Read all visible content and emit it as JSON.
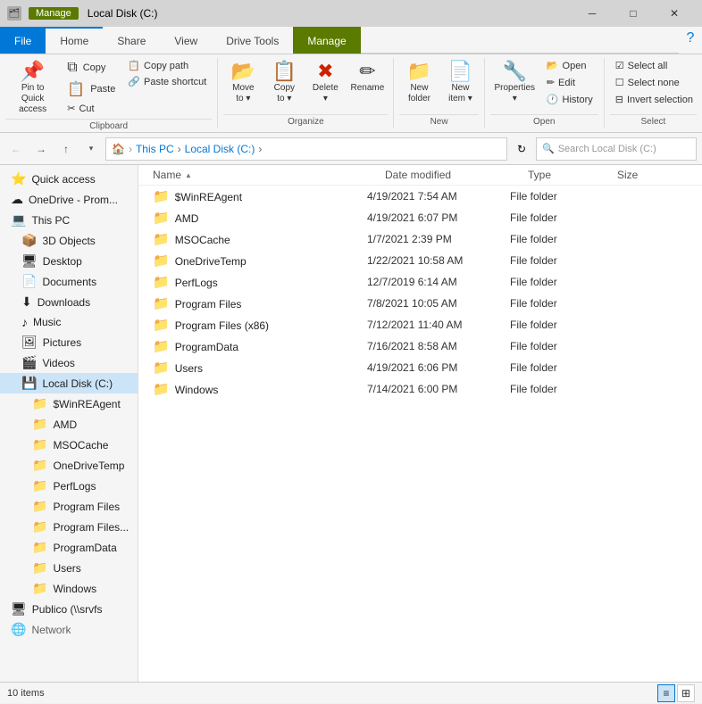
{
  "titlebar": {
    "manage_label": "Manage",
    "title": "Local Disk (C:)",
    "min": "─",
    "max": "□",
    "close": "✕"
  },
  "ribbon": {
    "tabs": [
      {
        "id": "file",
        "label": "File",
        "active_file": true
      },
      {
        "id": "home",
        "label": "Home",
        "active": true
      },
      {
        "id": "share",
        "label": "Share"
      },
      {
        "id": "view",
        "label": "View"
      },
      {
        "id": "drive_tools",
        "label": "Drive Tools"
      },
      {
        "id": "manage",
        "label": "Manage",
        "manage": true
      }
    ],
    "groups": {
      "clipboard": {
        "label": "Clipboard",
        "pin_label": "Pin to Quick\naccess",
        "copy_label": "Copy",
        "paste_label": "Paste",
        "cut_label": "Cut",
        "copy_path_label": "Copy path",
        "paste_shortcut_label": "Paste shortcut"
      },
      "organize": {
        "label": "Organize",
        "move_to_label": "Move\nto",
        "copy_to_label": "Copy\nto",
        "delete_label": "Delete",
        "rename_label": "Rename"
      },
      "new": {
        "label": "New",
        "new_folder_label": "New\nfolder"
      },
      "open": {
        "label": "Open",
        "properties_label": "Properties",
        "open_label": "Open",
        "edit_label": "Edit",
        "history_label": "History"
      },
      "select": {
        "label": "Select",
        "select_all_label": "Select all",
        "select_none_label": "Select none",
        "invert_label": "Invert selection"
      }
    }
  },
  "navbar": {
    "back": "←",
    "forward": "→",
    "up": "↑",
    "recent": "▾",
    "address": {
      "this_pc": "This PC",
      "sep1": ">",
      "local_disk": "Local Disk (C:)",
      "sep2": ">"
    },
    "refresh_icon": "↻",
    "search_placeholder": "Search Local Disk (C:)"
  },
  "sidebar": {
    "items": [
      {
        "id": "quick-access",
        "label": "Quick access",
        "icon": "⭐",
        "indent": 0
      },
      {
        "id": "onedrive",
        "label": "OneDrive - Prom...",
        "icon": "☁",
        "indent": 0
      },
      {
        "id": "this-pc",
        "label": "This PC",
        "icon": "💻",
        "indent": 0
      },
      {
        "id": "3d-objects",
        "label": "3D Objects",
        "icon": "📦",
        "indent": 1
      },
      {
        "id": "desktop",
        "label": "Desktop",
        "icon": "🖥",
        "indent": 1
      },
      {
        "id": "documents",
        "label": "Documents",
        "icon": "📄",
        "indent": 1
      },
      {
        "id": "downloads",
        "label": "Downloads",
        "icon": "⬇",
        "indent": 1
      },
      {
        "id": "music",
        "label": "Music",
        "icon": "♪",
        "indent": 1
      },
      {
        "id": "pictures",
        "label": "Pictures",
        "icon": "🖼",
        "indent": 1
      },
      {
        "id": "videos",
        "label": "Videos",
        "icon": "🎬",
        "indent": 1
      },
      {
        "id": "local-disk",
        "label": "Local Disk (C:)",
        "icon": "💾",
        "indent": 1,
        "active": true
      },
      {
        "id": "swinreagent",
        "label": "$WinREAgent",
        "icon": "📁",
        "indent": 2
      },
      {
        "id": "amd",
        "label": "AMD",
        "icon": "📁",
        "indent": 2
      },
      {
        "id": "msocache",
        "label": "MSOCache",
        "icon": "📁",
        "indent": 2
      },
      {
        "id": "onedrivetemp",
        "label": "OneDriveTemp",
        "icon": "📁",
        "indent": 2
      },
      {
        "id": "perflogs",
        "label": "PerfLogs",
        "icon": "📁",
        "indent": 2
      },
      {
        "id": "program-files",
        "label": "Program Files",
        "icon": "📁",
        "indent": 2
      },
      {
        "id": "program-files-x86",
        "label": "Program Files...",
        "icon": "📁",
        "indent": 2
      },
      {
        "id": "programdata",
        "label": "ProgramData",
        "icon": "📁",
        "indent": 2
      },
      {
        "id": "users",
        "label": "Users",
        "icon": "📁",
        "indent": 2
      },
      {
        "id": "windows",
        "label": "Windows",
        "icon": "📁",
        "indent": 2
      },
      {
        "id": "publico",
        "label": "Publico (\\\\srvfs",
        "icon": "🖥",
        "indent": 0
      },
      {
        "id": "network",
        "label": "Network",
        "icon": "🌐",
        "indent": 0
      }
    ]
  },
  "filelist": {
    "columns": {
      "name": "Name",
      "date_modified": "Date modified",
      "type": "Type",
      "size": "Size"
    },
    "files": [
      {
        "name": "$WinREAgent",
        "date": "4/19/2021 7:54 AM",
        "type": "File folder",
        "size": "",
        "icon": "📁"
      },
      {
        "name": "AMD",
        "date": "4/19/2021 6:07 PM",
        "type": "File folder",
        "size": "",
        "icon": "📁"
      },
      {
        "name": "MSOCache",
        "date": "1/7/2021 2:39 PM",
        "type": "File folder",
        "size": "",
        "icon": "📁"
      },
      {
        "name": "OneDriveTemp",
        "date": "1/22/2021 10:58 AM",
        "type": "File folder",
        "size": "",
        "icon": "📁"
      },
      {
        "name": "PerfLogs",
        "date": "12/7/2019 6:14 AM",
        "type": "File folder",
        "size": "",
        "icon": "📁"
      },
      {
        "name": "Program Files",
        "date": "7/8/2021 10:05 AM",
        "type": "File folder",
        "size": "",
        "icon": "📁"
      },
      {
        "name": "Program Files (x86)",
        "date": "7/12/2021 11:40 AM",
        "type": "File folder",
        "size": "",
        "icon": "📁"
      },
      {
        "name": "ProgramData",
        "date": "7/16/2021 8:58 AM",
        "type": "File folder",
        "size": "",
        "icon": "📁"
      },
      {
        "name": "Users",
        "date": "4/19/2021 6:06 PM",
        "type": "File folder",
        "size": "",
        "icon": "📁"
      },
      {
        "name": "Windows",
        "date": "7/14/2021 6:00 PM",
        "type": "File folder",
        "size": "",
        "icon": "📁"
      }
    ]
  },
  "statusbar": {
    "item_count": "10 items",
    "view_details": "≡",
    "view_tiles": "⊞"
  }
}
